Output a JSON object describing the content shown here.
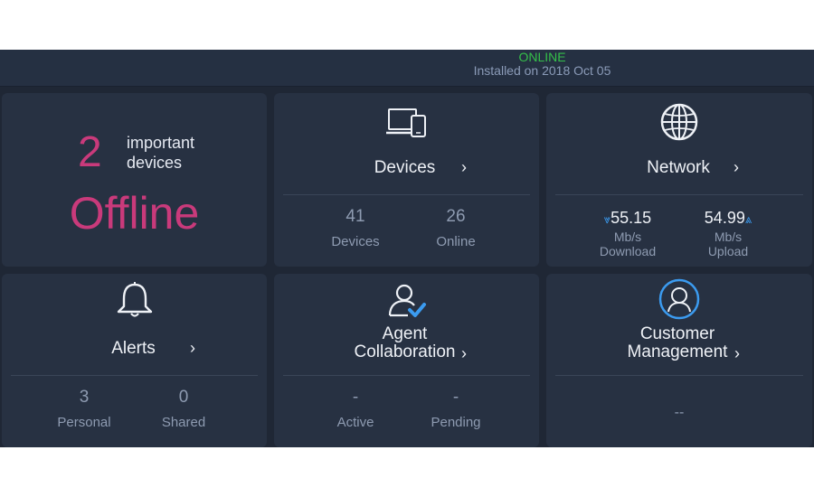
{
  "header": {
    "status": "ONLINE",
    "installed": "Installed on 2018 Oct 05"
  },
  "summary": {
    "count": "2",
    "label_line1": "important",
    "label_line2": "devices",
    "state": "Offline"
  },
  "devices": {
    "title": "Devices",
    "stats": [
      {
        "value": "41",
        "label": "Devices"
      },
      {
        "value": "26",
        "label": "Online"
      }
    ]
  },
  "network": {
    "title": "Network",
    "download": {
      "value": "55.15",
      "unit": "Mb/s",
      "label": "Download"
    },
    "upload": {
      "value": "54.99",
      "unit": "Mb/s",
      "label": "Upload"
    }
  },
  "alerts": {
    "title": "Alerts",
    "stats": [
      {
        "value": "3",
        "label": "Personal"
      },
      {
        "value": "0",
        "label": "Shared"
      }
    ]
  },
  "agent": {
    "title_line1": "Agent",
    "title_line2": "Collaboration",
    "stats": [
      {
        "value": "-",
        "label": "Active"
      },
      {
        "value": "-",
        "label": "Pending"
      }
    ]
  },
  "customer": {
    "title_line1": "Customer",
    "title_line2": "Management",
    "value": "--"
  },
  "colors": {
    "accent_pink": "#c93a7b",
    "online_green": "#35c04a",
    "arrow_blue": "#3b9bf0",
    "panel": "#273142",
    "background": "#1f2735"
  },
  "icons": {
    "devices": "devices-icon",
    "network": "globe-icon",
    "alerts": "bell-icon",
    "agent": "agent-check-icon",
    "customer": "customer-avatar-icon",
    "chevron": "chevron-right-icon"
  }
}
